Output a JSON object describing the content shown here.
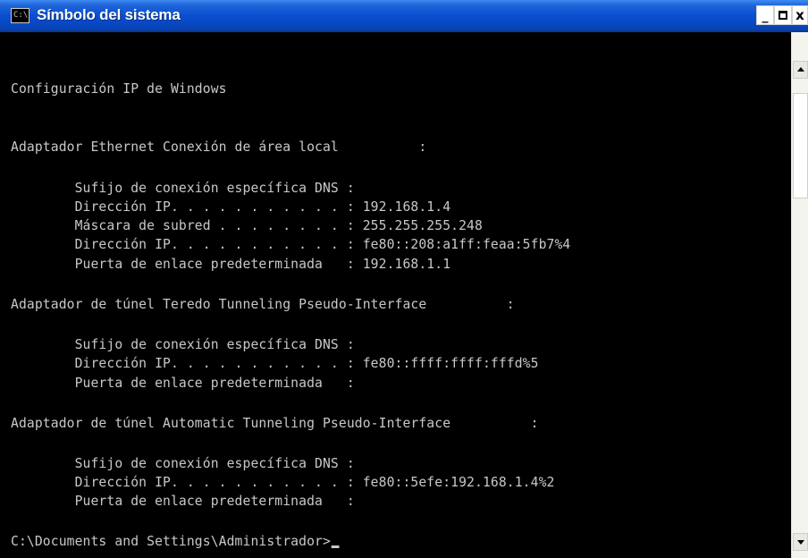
{
  "window": {
    "title": "Símbolo del sistema",
    "icon": "console-icon",
    "icon_text": "C:\\",
    "controls": {
      "minimize": "_",
      "maximize": "maximize",
      "close": "x"
    }
  },
  "console": {
    "lines": [
      "Configuración IP de Windows",
      "Adaptador Ethernet Conexión de área local          :",
      "        Sufijo de conexión específica DNS :",
      "        Dirección IP. . . . . . . . . . . : 192.168.1.4",
      "        Máscara de subred . . . . . . . . : 255.255.255.248",
      "        Dirección IP. . . . . . . . . . . : fe80::208:a1ff:feaa:5fb7%4",
      "        Puerta de enlace predeterminada   : 192.168.1.1",
      "Adaptador de túnel Teredo Tunneling Pseudo-Interface          :",
      "        Sufijo de conexión específica DNS :",
      "        Dirección IP. . . . . . . . . . . : fe80::ffff:ffff:fffd%5",
      "        Puerta de enlace predeterminada   :",
      "Adaptador de túnel Automatic Tunneling Pseudo-Interface          :",
      "        Sufijo de conexión específica DNS :",
      "        Dirección IP. . . . . . . . . . . : fe80::5efe:192.168.1.4%2",
      "        Puerta de enlace predeterminada   :"
    ],
    "prompt": "C:\\Documents and Settings\\Administrador>"
  },
  "scrollbar": {
    "up_icon": "arrow-up-icon",
    "down_icon": "arrow-down-icon"
  },
  "colors": {
    "titlebar": "#0a4fd0",
    "console_bg": "#000000",
    "console_text": "#c8c8c8"
  }
}
